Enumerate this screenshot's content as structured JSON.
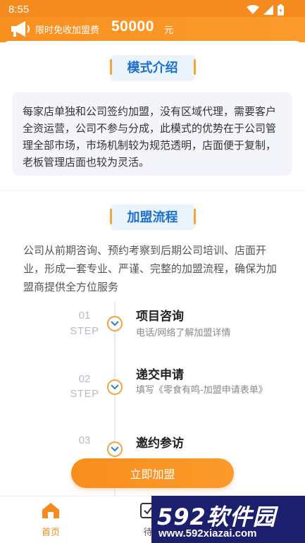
{
  "status": {
    "time": "8:55"
  },
  "promo": {
    "text": "限时免收加盟费",
    "amount": "50000",
    "unit": "元"
  },
  "model": {
    "title": "模式介绍",
    "description": "每家店单独和公司签约加盟，没有区域代理，需要客户全资运营，公司不参与分成，此模式的优势在于公司管理全部市场，市场机制较为规范透明，店面便于复制，老板管理店面也较为灵活。"
  },
  "flow": {
    "title": "加盟流程",
    "description": "公司从前期咨询、预约考察到后期公司培训、店面开业，形成一套专业、严谨、完整的加盟流程，确保为加盟商提供全方位服务",
    "step_label": "STEP",
    "steps": [
      {
        "no": "01",
        "title": "项目咨询",
        "sub": "电话/网络了解加盟详情"
      },
      {
        "no": "02",
        "title": "递交申请",
        "sub": "填写《零食有鸣-加盟申请表单》"
      },
      {
        "no": "03",
        "title": "邀约参访",
        "sub": ""
      }
    ]
  },
  "action": {
    "join_label": "立即加盟"
  },
  "tabs": {
    "home": "首页",
    "pending": "待"
  },
  "watermark": {
    "num": "592",
    "cn": "软件园",
    "url": "www.592xiazai.com"
  },
  "colors": {
    "accent": "#f58a1f",
    "title_blue": "#1f6fcc"
  }
}
